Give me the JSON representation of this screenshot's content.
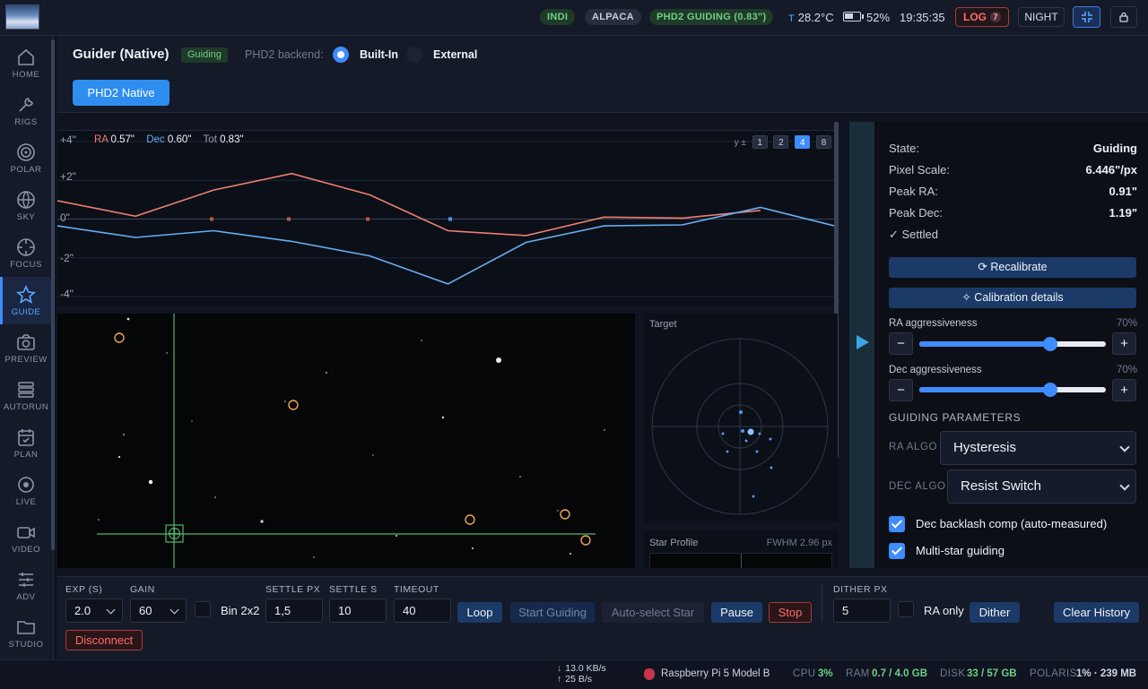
{
  "topbar": {
    "pills": {
      "indi": "INDI",
      "alpaca": "ALPACA",
      "phd2": "PHD2 GUIDING (0.83\")"
    },
    "temp_prefix": "T",
    "temperature": "28.2°C",
    "battery": "52%",
    "time": "19:35:35",
    "log_label": "LOG",
    "log_count": "7",
    "night_label": "NIGHT"
  },
  "sidebar": {
    "items": [
      {
        "label": "HOME",
        "icon": "home-icon"
      },
      {
        "label": "RIGS",
        "icon": "wrench-icon"
      },
      {
        "label": "POLAR",
        "icon": "polar-target-icon"
      },
      {
        "label": "SKY",
        "icon": "globe-icon"
      },
      {
        "label": "FOCUS",
        "icon": "focus-icon"
      },
      {
        "label": "GUIDE",
        "icon": "star-icon"
      },
      {
        "label": "PREVIEW",
        "icon": "camera-icon"
      },
      {
        "label": "AUTORUN",
        "icon": "stack-icon"
      },
      {
        "label": "PLAN",
        "icon": "calendar-check-icon"
      },
      {
        "label": "LIVE",
        "icon": "live-dot-icon"
      },
      {
        "label": "VIDEO",
        "icon": "video-icon"
      },
      {
        "label": "ADV",
        "icon": "list-icon"
      },
      {
        "label": "STUDIO",
        "icon": "folder-icon"
      }
    ],
    "active": "GUIDE"
  },
  "header": {
    "title": "Guider (Native)",
    "status": "Guiding",
    "backend_label": "PHD2 backend:",
    "backend_options": [
      "Built-In",
      "External"
    ],
    "backend_selected": "Built-In",
    "tab": "PHD2 Native"
  },
  "graph": {
    "y_labels": [
      "+4\"",
      "+2\"",
      "0\"",
      "-2\"",
      "-4\""
    ],
    "legend": {
      "ra_label": "RA",
      "ra_value": "0.57\"",
      "dec_label": "Dec",
      "dec_value": "0.60\"",
      "tot_label": "Tot",
      "tot_value": "0.83\""
    },
    "y_scale_label": "y ±",
    "y_scale_options": [
      "1",
      "2",
      "4",
      "8"
    ],
    "y_scale_selected": "4",
    "colors": {
      "ra": "#f07f6e",
      "dec": "#69aef2"
    }
  },
  "chart_data": {
    "type": "line",
    "x": [
      0,
      1,
      2,
      3,
      4,
      5,
      6,
      7,
      8,
      9,
      10
    ],
    "ylim": [
      -4,
      4
    ],
    "series": [
      {
        "name": "RA",
        "values": [
          0.95,
          0.15,
          1.5,
          2.35,
          1.25,
          -0.6,
          -0.85,
          0.1,
          0.05,
          0.45
        ]
      },
      {
        "name": "Dec",
        "values": [
          -0.35,
          -0.95,
          -0.6,
          -1.15,
          -1.9,
          -3.35,
          -1.2,
          -0.35,
          -0.3,
          0.6,
          -0.4
        ]
      }
    ]
  },
  "target": {
    "title": "Target"
  },
  "star_profile": {
    "title": "Star Profile",
    "fwhm": "FWHM 2.96 px"
  },
  "stats": {
    "state_label": "State:",
    "state_value": "Guiding",
    "pixel_scale_label": "Pixel Scale:",
    "pixel_scale_value": "6.446\"/px",
    "peak_ra_label": "Peak RA:",
    "peak_ra_value": "0.91\"",
    "peak_dec_label": "Peak Dec:",
    "peak_dec_value": "1.19\"",
    "settled": "✓ Settled"
  },
  "right": {
    "recalibrate": "⟳ Recalibrate",
    "calibration_details": "✧ Calibration details",
    "ra_aggr_label": "RA aggressiveness",
    "ra_aggr_pct": "70%",
    "ra_aggr_value": 0.7,
    "dec_aggr_label": "Dec aggressiveness",
    "dec_aggr_pct": "70%",
    "dec_aggr_value": 0.7,
    "guiding_params_title": "GUIDING PARAMETERS",
    "ra_algo_label": "RA ALGO",
    "ra_algo_value": "Hysteresis",
    "dec_algo_label": "DEC ALGO",
    "dec_algo_value": "Resist Switch",
    "backlash_label": "Dec backlash comp (auto-measured)",
    "multistar_label": "Multi-star guiding"
  },
  "controls": {
    "exp_label": "EXP (S)",
    "exp_value": "2.0",
    "gain_label": "GAIN",
    "gain_value": "60",
    "bin_label": "Bin 2x2",
    "settle_px_label": "SETTLE PX",
    "settle_px_value": "1,5",
    "settle_s_label": "SETTLE S",
    "settle_s_value": "10",
    "timeout_label": "TIMEOUT",
    "timeout_value": "40",
    "loop": "Loop",
    "start_guiding": "Start Guiding",
    "auto_select": "Auto-select Star",
    "pause": "Pause",
    "stop": "Stop",
    "dither_px_label": "DITHER PX",
    "dither_px_value": "5",
    "ra_only_label": "RA only",
    "dither": "Dither",
    "clear_history": "Clear History",
    "disconnect": "Disconnect"
  },
  "statusbar": {
    "down": "13.0 KB/s",
    "up": "25 B/s",
    "device": "Raspberry Pi 5 Model B",
    "cpu_label": "CPU",
    "cpu_value": "3%",
    "ram_label": "RAM",
    "ram_value": "0.7 / 4.0 GB",
    "disk_label": "DISK",
    "disk_value": "33 / 57 GB",
    "polaris_label": "POLARIS",
    "polaris_value": "1% · 239 MB"
  }
}
